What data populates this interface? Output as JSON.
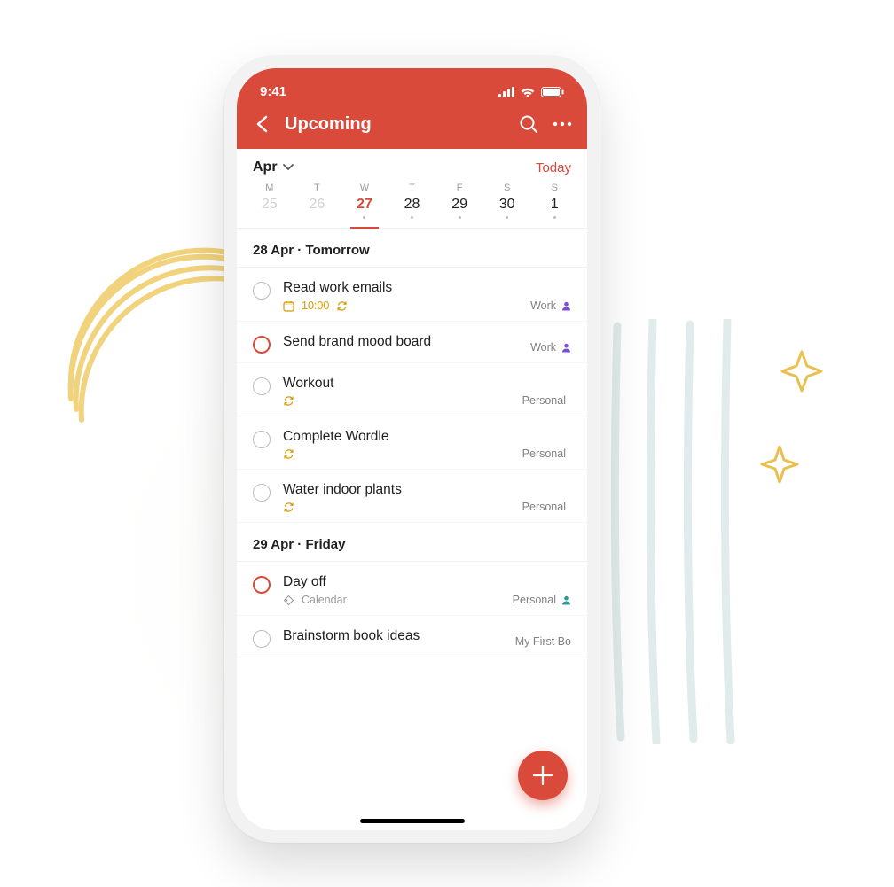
{
  "status": {
    "time": "9:41"
  },
  "header": {
    "title": "Upcoming"
  },
  "monthrow": {
    "month": "Apr",
    "today": "Today"
  },
  "week": [
    {
      "label": "M",
      "num": "25",
      "dim": true,
      "dot": false
    },
    {
      "label": "T",
      "num": "26",
      "dim": true,
      "dot": false
    },
    {
      "label": "W",
      "num": "27",
      "sel": true,
      "dot": true
    },
    {
      "label": "T",
      "num": "28",
      "dot": true
    },
    {
      "label": "F",
      "num": "29",
      "dot": true
    },
    {
      "label": "S",
      "num": "30",
      "dot": true
    },
    {
      "label": "S",
      "num": "1",
      "dot": true
    }
  ],
  "sections": [
    {
      "header": "28 Apr · Tomorrow",
      "tasks": [
        {
          "name": "Read work emails",
          "priority": false,
          "time": "10:00",
          "timeIcon": "calendar",
          "recurring": true,
          "project": "Work",
          "projectColor": "purple",
          "projectIcon": "person"
        },
        {
          "name": "Send brand mood board",
          "priority": true,
          "project": "Work",
          "projectColor": "purple",
          "projectIcon": "person"
        },
        {
          "name": "Workout",
          "priority": false,
          "recurring": true,
          "project": "Personal",
          "projectColor": "green",
          "projectIcon": "dot"
        },
        {
          "name": "Complete Wordle",
          "priority": false,
          "recurring": true,
          "project": "Personal",
          "projectColor": "green",
          "projectIcon": "dot"
        },
        {
          "name": "Water indoor plants",
          "priority": false,
          "recurring": true,
          "project": "Personal",
          "projectColor": "green",
          "projectIcon": "dot"
        }
      ]
    },
    {
      "header": "29 Apr · Friday",
      "tasks": [
        {
          "name": "Day off",
          "priority": true,
          "label": "Calendar",
          "labelIcon": "tag",
          "project": "Personal",
          "projectColor": "teal",
          "projectIcon": "person"
        },
        {
          "name": "Brainstorm book ideas",
          "priority": false,
          "project": "My First Bo",
          "projectColor": "",
          "projectIcon": "none"
        }
      ]
    }
  ],
  "icons": {
    "recurringGlyph": "⟳"
  }
}
